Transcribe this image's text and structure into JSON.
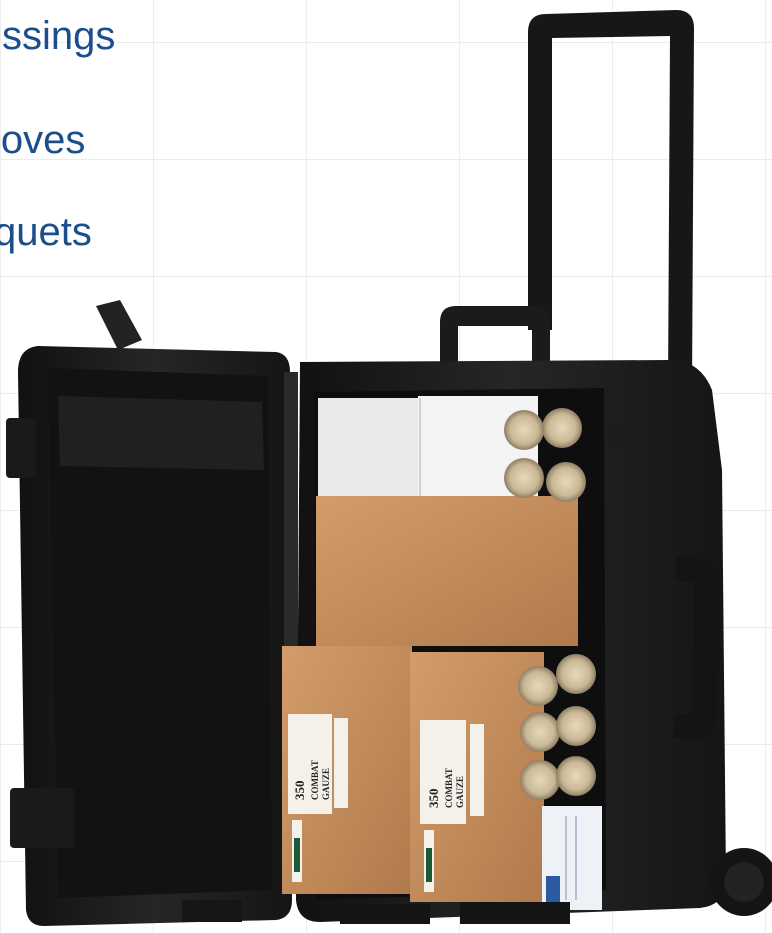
{
  "captions": [
    "ssings",
    "loves",
    "quets"
  ],
  "box_labels": {
    "left": {
      "number": "350",
      "line1": "COMBAT",
      "line2": "GAUZE"
    },
    "right": {
      "number": "350",
      "line1": "COMBAT",
      "line2": "GAUZE"
    }
  },
  "colors": {
    "caption": "#1a4f8b",
    "case": "#1d1d1d",
    "cardboard": "#c58e5e",
    "white_box": "#ececec"
  }
}
